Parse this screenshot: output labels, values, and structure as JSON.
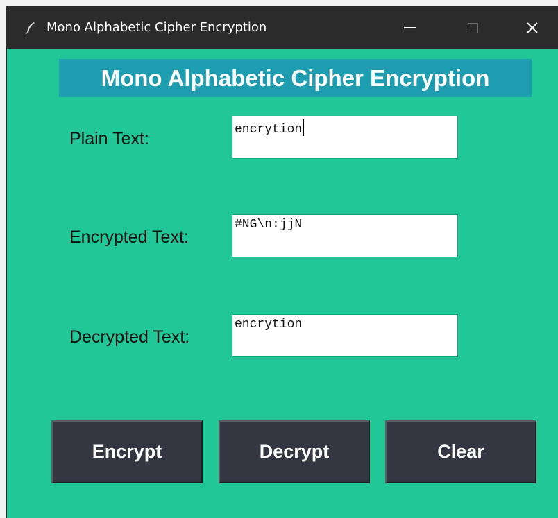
{
  "window": {
    "title": "Mono Alphabetic Cipher Encryption",
    "icon": "feather-icon",
    "controls": [
      "minimize-icon",
      "maximize-icon",
      "close-icon"
    ]
  },
  "heading": "Mono Alphabetic Cipher Encryption",
  "form": {
    "plain_label": "Plain Text:",
    "plain_value": "encrytion",
    "encrypted_label": "Encrypted Text:",
    "encrypted_value": "#NG\\n:jjN",
    "decrypted_label": "Decrypted Text:",
    "decrypted_value": "encrytion"
  },
  "buttons": {
    "encrypt": "Encrypt",
    "decrypt": "Decrypt",
    "clear": "Clear"
  },
  "colors": {
    "background": "#21c797",
    "heading_bg": "#1e9db1",
    "button_bg": "#343741",
    "titlebar": "#2b2b2b"
  }
}
